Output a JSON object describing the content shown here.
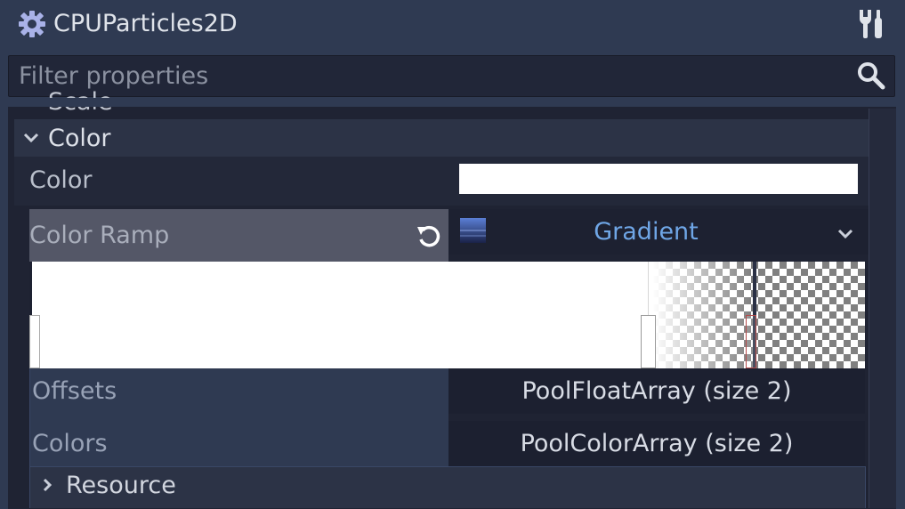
{
  "header": {
    "title": "CPUParticles2D",
    "node_icon": "particles-gear-icon",
    "tools_icon": "tools-icon"
  },
  "filter": {
    "placeholder": "Filter properties",
    "icon": "search-icon"
  },
  "sections": {
    "scale_partial_label": "Scale",
    "color_section": {
      "title": "Color",
      "expanded": true
    },
    "color_property": {
      "label": "Color",
      "value_color": "#ffffff"
    },
    "color_ramp": {
      "label": "Color Ramp",
      "resource_type": "Gradient",
      "revert_icon": "revert-icon"
    },
    "offsets": {
      "label": "Offsets",
      "value": "PoolFloatArray (size 2)"
    },
    "colors": {
      "label": "Colors",
      "value": "PoolColorArray (size 2)"
    },
    "resource": {
      "title": "Resource",
      "expanded": false
    }
  },
  "colors": {
    "background": "#2f3a52",
    "panel": "#1f2333",
    "accent_text": "#6fa6e6",
    "gradient_start": "#ffffff",
    "gradient_end": "rgba(255,255,255,0)"
  }
}
